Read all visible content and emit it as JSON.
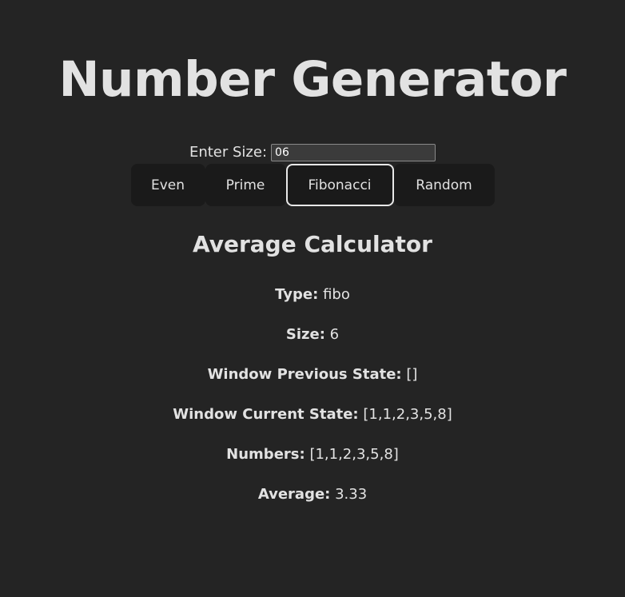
{
  "header": {
    "title": "Number Generator"
  },
  "size_input": {
    "label": "Enter Size:",
    "value": "06"
  },
  "buttons": {
    "even": "Even",
    "prime": "Prime",
    "fibonacci": "Fibonacci",
    "random": "Random",
    "active": "fibonacci"
  },
  "calculator": {
    "title": "Average Calculator",
    "type_label": "Type:",
    "type_value": "fibo",
    "size_label": "Size:",
    "size_value": "6",
    "prev_label": "Window Previous State:",
    "prev_value": "[]",
    "curr_label": "Window Current State:",
    "curr_value": "[1,1,2,3,5,8]",
    "numbers_label": "Numbers:",
    "numbers_value": "[1,1,2,3,5,8]",
    "average_label": "Average:",
    "average_value": "3.33"
  },
  "colors": {
    "background": "#242424",
    "button_bg": "#1a1a1a",
    "active_border": "#e8e8e8",
    "text": "#dedede"
  }
}
